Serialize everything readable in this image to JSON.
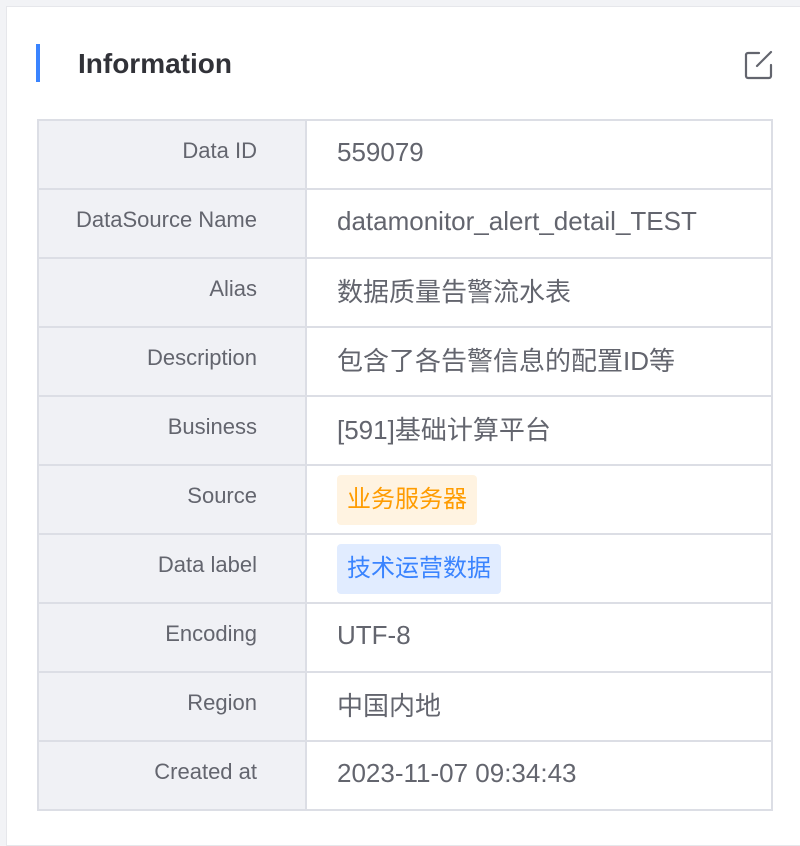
{
  "header": {
    "title": "Information",
    "edit_icon": "edit-icon"
  },
  "colors": {
    "accent": "#3a84ff",
    "source_tag_bg": "#fff3e1",
    "source_tag_text": "#ff9c01",
    "label_tag_bg": "#e1ecff",
    "label_tag_text": "#3a84ff"
  },
  "rows": [
    {
      "label": "Data ID",
      "value": "559079"
    },
    {
      "label": "DataSource Name",
      "value": "datamonitor_alert_detail_TEST"
    },
    {
      "label": "Alias",
      "value": "数据质量告警流水表"
    },
    {
      "label": "Description",
      "value": "包含了各告警信息的配置ID等"
    },
    {
      "label": "Business",
      "value": "[591]基础计算平台"
    },
    {
      "label": "Source",
      "value": "业务服务器"
    },
    {
      "label": "Data label",
      "value": "技术运营数据"
    },
    {
      "label": "Encoding",
      "value": "UTF-8"
    },
    {
      "label": "Region",
      "value": "中国内地"
    },
    {
      "label": "Created at",
      "value": "2023-11-07 09:34:43"
    }
  ]
}
